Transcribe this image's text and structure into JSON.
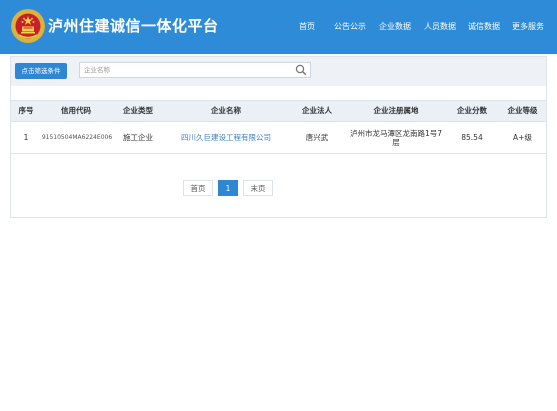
{
  "header": {
    "title": "泸州住建诚信一体化平台",
    "nav": [
      "首页",
      "公告公示",
      "企业数据",
      "人员数据",
      "诚信数据",
      "更多服务"
    ]
  },
  "filter": {
    "button_label": "点击筛选条件",
    "search_placeholder": "企业名称"
  },
  "table": {
    "headers": [
      "序号",
      "信用代码",
      "企业类型",
      "企业名称",
      "企业法人",
      "企业注册属地",
      "企业分数",
      "企业等级"
    ],
    "rows": [
      {
        "index": "1",
        "credit_code": "91510504MA6224E006",
        "type": "施工企业",
        "name": "四川久巨建设工程有限公司",
        "legal_person": "唐兴武",
        "address": "泸州市龙马潭区龙南路1号7层",
        "score": "85.54",
        "grade": "A+级"
      }
    ]
  },
  "pagination": {
    "first": "首页",
    "current": "1",
    "last": "末页"
  },
  "colors": {
    "header_bg": "#2d8bd8",
    "button_bg": "#2f86d3",
    "table_head_bg": "#eaf0f6",
    "filter_bg": "#eef2f6",
    "link": "#3f7fc2"
  }
}
